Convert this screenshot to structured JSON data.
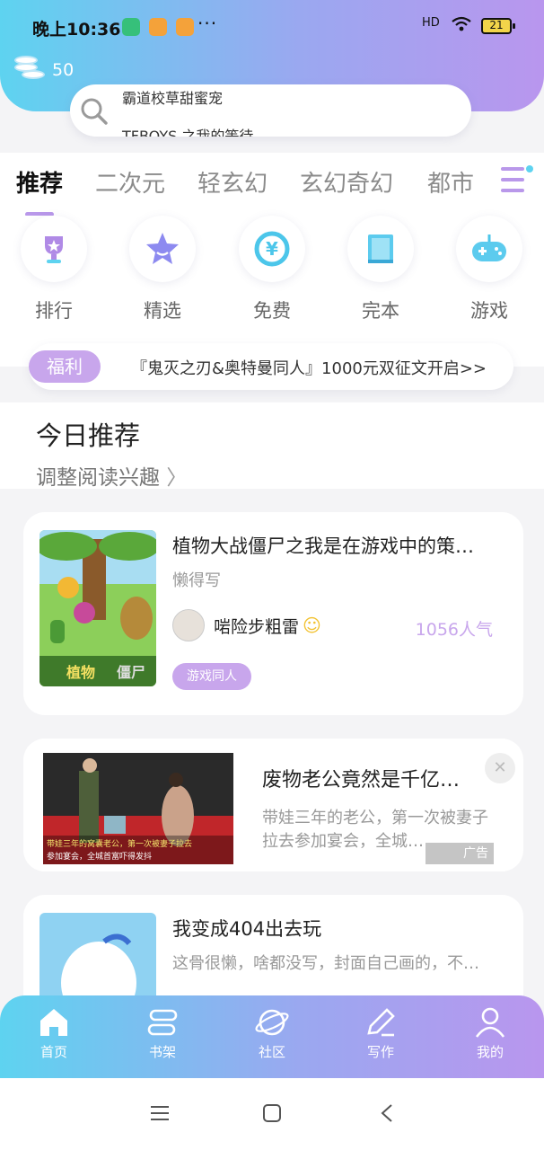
{
  "status_bar": {
    "time": "晚上10:36",
    "signal": "HD",
    "battery": "21",
    "more": "···"
  },
  "header": {
    "coins": "50",
    "search_line1": "霸道校草甜蜜宠",
    "search_line2": "TFBOYS 之我的等待"
  },
  "tabs": [
    "推荐",
    "二次元",
    "轻玄幻",
    "玄幻奇幻",
    "都市"
  ],
  "categories": [
    {
      "label": "排行",
      "icon": "trophy-icon"
    },
    {
      "label": "精选",
      "icon": "star-icon"
    },
    {
      "label": "免费",
      "icon": "yuan-icon"
    },
    {
      "label": "完本",
      "icon": "book-icon"
    },
    {
      "label": "游戏",
      "icon": "gamepad-icon"
    }
  ],
  "fuli": {
    "badge": "福利",
    "text": "『鬼灭之刃&奥特曼同人』1000元双征文开启>>"
  },
  "today": {
    "title": "今日推荐",
    "subtitle": "调整阅读兴趣"
  },
  "cards": [
    {
      "title": "植物大战僵尸之我是在游戏中的策…",
      "author": "懒得写",
      "username": "啱险步粗雷",
      "popularity": "1056人气",
      "tag": "游戏同人"
    },
    {
      "title": "废物老公竟然是千亿…",
      "desc": "带娃三年的老公，第一次被妻子拉去参加宴会，全城…",
      "ad_label": "广告",
      "caption1": "带娃三年的窝囊老公，第一次被妻子拉去",
      "caption2": "参加宴会，全城首富吓得发抖"
    },
    {
      "title": "我变成404出去玩",
      "desc": "这骨很懒，啥都没写，封面自己画的，不…"
    }
  ],
  "bottom_nav": [
    {
      "label": "首页",
      "icon": "home-icon"
    },
    {
      "label": "书架",
      "icon": "bookshelf-icon"
    },
    {
      "label": "社区",
      "icon": "planet-icon"
    },
    {
      "label": "写作",
      "icon": "pen-icon"
    },
    {
      "label": "我的",
      "icon": "user-icon"
    }
  ],
  "colors": {
    "accent": "#c8a6ec",
    "gradient_start": "#5ed3f0",
    "gradient_end": "#b996ee"
  }
}
